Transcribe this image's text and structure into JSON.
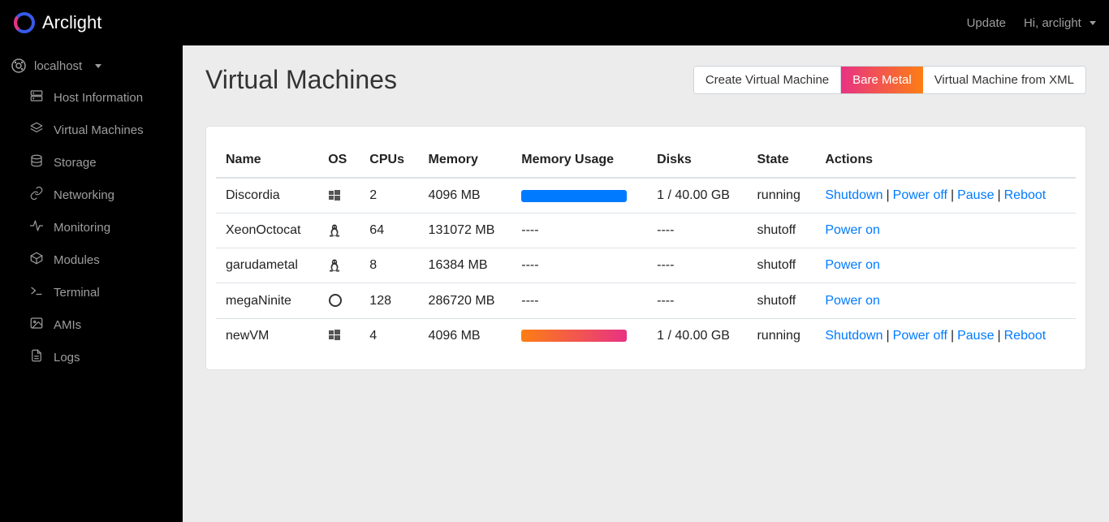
{
  "brand": "Arclight",
  "top": {
    "update": "Update",
    "user": "Hi, arclight"
  },
  "host": {
    "label": "localhost"
  },
  "sidebar": {
    "items": [
      {
        "label": "Host Information",
        "icon": "server"
      },
      {
        "label": "Virtual Machines",
        "icon": "layers"
      },
      {
        "label": "Storage",
        "icon": "database"
      },
      {
        "label": "Networking",
        "icon": "link"
      },
      {
        "label": "Monitoring",
        "icon": "activity"
      },
      {
        "label": "Modules",
        "icon": "package"
      },
      {
        "label": "Terminal",
        "icon": "terminal"
      },
      {
        "label": "AMIs",
        "icon": "image"
      },
      {
        "label": "Logs",
        "icon": "file"
      }
    ]
  },
  "page": {
    "title": "Virtual Machines",
    "buttons": {
      "create": "Create Virtual Machine",
      "bare": "Bare Metal",
      "xml": "Virtual Machine from XML"
    }
  },
  "table": {
    "headers": {
      "name": "Name",
      "os": "OS",
      "cpus": "CPUs",
      "memory": "Memory",
      "mem_usage": "Memory Usage",
      "disks": "Disks",
      "state": "State",
      "actions": "Actions"
    },
    "rows": [
      {
        "name": "Discordia",
        "os": "windows",
        "cpus": "2",
        "memory": "4096 MB",
        "mem_usage_bar": "blue",
        "mem_usage_text": "",
        "disks": "1 / 40.00 GB",
        "state": "running",
        "actions": [
          "Shutdown",
          "Power off",
          "Pause",
          "Reboot"
        ]
      },
      {
        "name": "XeonOctocat",
        "os": "linux",
        "cpus": "64",
        "memory": "131072 MB",
        "mem_usage_bar": "",
        "mem_usage_text": "----",
        "disks": "----",
        "state": "shutoff",
        "actions": [
          "Power on"
        ]
      },
      {
        "name": "garudametal",
        "os": "linux",
        "cpus": "8",
        "memory": "16384 MB",
        "mem_usage_bar": "",
        "mem_usage_text": "----",
        "disks": "----",
        "state": "shutoff",
        "actions": [
          "Power on"
        ]
      },
      {
        "name": "megaNinite",
        "os": "other",
        "cpus": "128",
        "memory": "286720 MB",
        "mem_usage_bar": "",
        "mem_usage_text": "----",
        "disks": "----",
        "state": "shutoff",
        "actions": [
          "Power on"
        ]
      },
      {
        "name": "newVM",
        "os": "windows",
        "cpus": "4",
        "memory": "4096 MB",
        "mem_usage_bar": "grad",
        "mem_usage_text": "",
        "disks": "1 / 40.00 GB",
        "state": "running",
        "actions": [
          "Shutdown",
          "Power off",
          "Pause",
          "Reboot"
        ]
      }
    ]
  }
}
